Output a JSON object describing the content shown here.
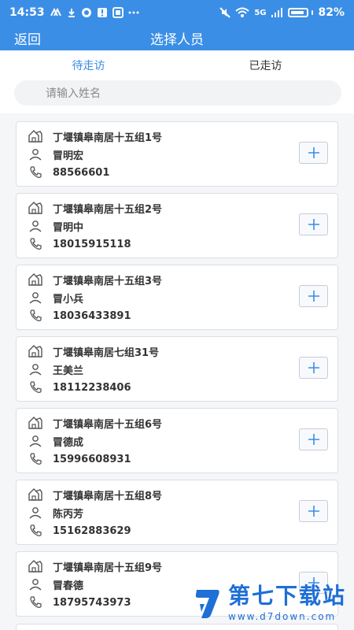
{
  "status_bar": {
    "time": "14:53",
    "left_icons": [
      "chevron-icon",
      "download-icon",
      "circle-icon",
      "alert-icon",
      "square-icon",
      "more-icon"
    ],
    "right_icons": [
      "mute-icon",
      "wifi-icon",
      "5g-signal-icon"
    ],
    "network": "5G",
    "battery_percent": "82%",
    "battery_level": 0.82
  },
  "nav": {
    "back_label": "返回",
    "title": "选择人员"
  },
  "tabs": [
    {
      "label": "待走访",
      "active": true
    },
    {
      "label": "已走访",
      "active": false
    }
  ],
  "search": {
    "placeholder": "请输入姓名",
    "value": ""
  },
  "records": [
    {
      "address": "丁堰镇皋南居十五组1号",
      "name": "冒明宏",
      "phone": "88566601"
    },
    {
      "address": "丁堰镇皋南居十五组2号",
      "name": "冒明中",
      "phone": "18015915118"
    },
    {
      "address": "丁堰镇皋南居十五组3号",
      "name": "冒小兵",
      "phone": "18036433891"
    },
    {
      "address": "丁堰镇皋南居七组31号",
      "name": "王美兰",
      "phone": "18112238406"
    },
    {
      "address": "丁堰镇皋南居十五组6号",
      "name": "冒德成",
      "phone": "15996608931"
    },
    {
      "address": "丁堰镇皋南居十五组8号",
      "name": "陈丙芳",
      "phone": "15162883629"
    },
    {
      "address": "丁堰镇皋南居十五组9号",
      "name": "冒春德",
      "phone": "18795743973"
    }
  ],
  "watermark": {
    "title": "第七下载站",
    "url": "www.d7down.com"
  },
  "colors": {
    "brand_blue": "#3a8ee6",
    "card_border": "#dcdfe6",
    "bg_gray": "#f5f6f7"
  }
}
